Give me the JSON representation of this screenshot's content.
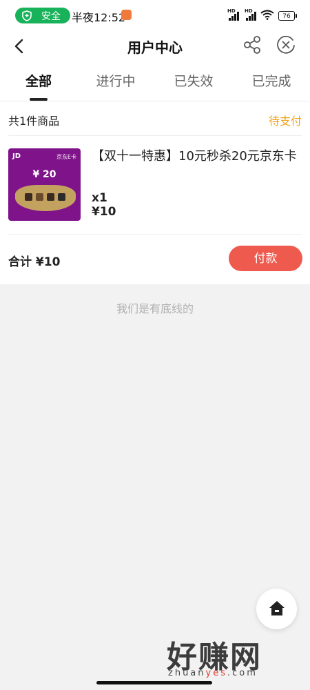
{
  "status_bar": {
    "safe_label": "安全",
    "time": "半夜12:52",
    "network_badge": "HD",
    "battery": "76"
  },
  "header": {
    "title": "用户中心",
    "back_icon": "chevron-left-icon",
    "share_icon": "share-icon",
    "close_icon": "close-circle-icon"
  },
  "tabs": [
    {
      "label": "全部",
      "active": true
    },
    {
      "label": "进行中",
      "active": false
    },
    {
      "label": "已失效",
      "active": false
    },
    {
      "label": "已完成",
      "active": false
    }
  ],
  "order": {
    "count_label": "共1件商品",
    "status": "待支付",
    "status_color": "#f0a21a",
    "product": {
      "title": "【双十一特惠】10元秒杀20元京东卡",
      "quantity": "x1",
      "price": "¥10",
      "image": {
        "brand": "JD",
        "card_name": "京东E卡",
        "face_value": "¥ 20"
      }
    },
    "total_label": "合计",
    "total_value": "¥10",
    "pay_button": "付款",
    "pay_color": "#ee5a4e"
  },
  "footer_text": "我们是有底线的",
  "fab": {
    "icon": "home-icon"
  },
  "watermark": {
    "main": "好赚网",
    "sub_a": "zhuan",
    "sub_b": "yes",
    "sub_c": ".com"
  }
}
